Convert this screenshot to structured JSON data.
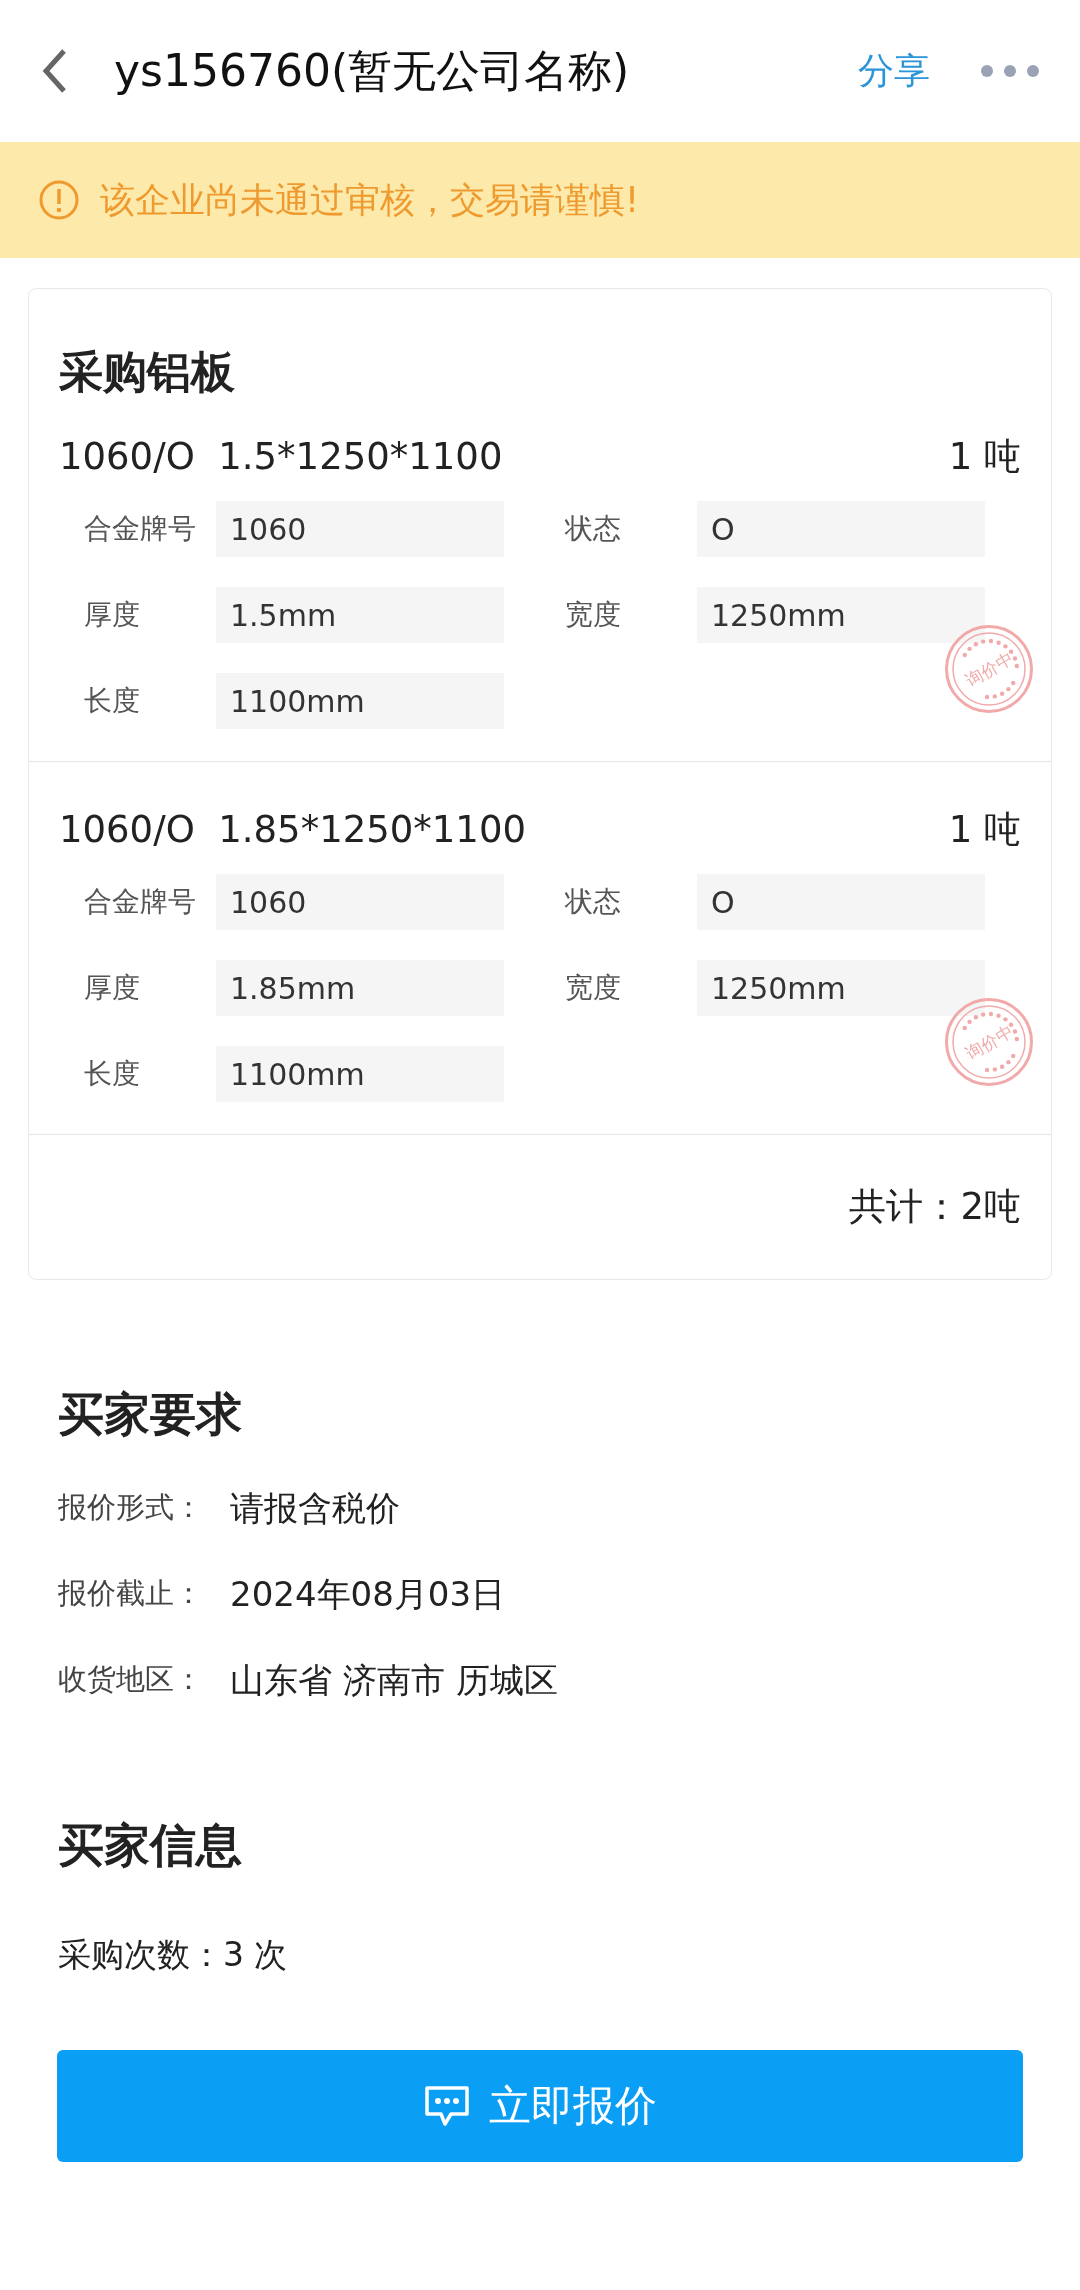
{
  "header": {
    "title": "ys156760(暂无公司名称)",
    "share": "分享"
  },
  "warning": {
    "text": "该企业尚未通过审核，交易请谨慎!"
  },
  "purchase": {
    "title": "采购铝板",
    "items": [
      {
        "name": "1060/O  1.5*1250*1100",
        "quantity": "1 吨",
        "stamp": "询价中",
        "fields": [
          {
            "label": "合金牌号",
            "value": "1060"
          },
          {
            "label": "状态",
            "value": "O"
          },
          {
            "label": "厚度",
            "value": "1.5mm"
          },
          {
            "label": "宽度",
            "value": "1250mm"
          },
          {
            "label": "长度",
            "value": "1100mm"
          }
        ]
      },
      {
        "name": "1060/O  1.85*1250*1100",
        "quantity": "1 吨",
        "stamp": "询价中",
        "fields": [
          {
            "label": "合金牌号",
            "value": "1060"
          },
          {
            "label": "状态",
            "value": "O"
          },
          {
            "label": "厚度",
            "value": "1.85mm"
          },
          {
            "label": "宽度",
            "value": "1250mm"
          },
          {
            "label": "长度",
            "value": "1100mm"
          }
        ]
      }
    ],
    "total": "共计：2吨"
  },
  "requirements": {
    "title": "买家要求",
    "rows": [
      {
        "label": "报价形式：",
        "value": "请报含税价"
      },
      {
        "label": "报价截止：",
        "value": "2024年08月03日"
      },
      {
        "label": "收货地区：",
        "value": "山东省 济南市 历城区"
      }
    ]
  },
  "buyer_info": {
    "title": "买家信息",
    "purchase_count": "采购次数：3 次"
  },
  "quote_button": "立即报价"
}
